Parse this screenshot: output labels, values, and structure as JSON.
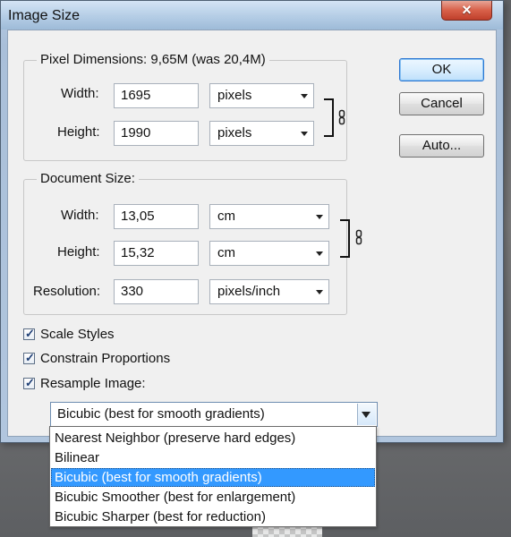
{
  "window": {
    "title": "Image Size",
    "close_icon": "close-icon"
  },
  "buttons": {
    "ok": "OK",
    "cancel": "Cancel",
    "auto": "Auto..."
  },
  "pixel_dimensions": {
    "title": "Pixel Dimensions:  9,65M (was 20,4M)",
    "width_label": "Width:",
    "width_value": "1695",
    "width_unit": "pixels",
    "height_label": "Height:",
    "height_value": "1990",
    "height_unit": "pixels",
    "link_icon": "link-icon"
  },
  "document_size": {
    "title": "Document Size:",
    "width_label": "Width:",
    "width_value": "13,05",
    "width_unit": "cm",
    "height_label": "Height:",
    "height_value": "15,32",
    "height_unit": "cm",
    "resolution_label": "Resolution:",
    "resolution_value": "330",
    "resolution_unit": "pixels/inch",
    "link_icon": "link-icon"
  },
  "options": {
    "scale_styles": {
      "label": "Scale Styles",
      "checked": true
    },
    "constrain_proportions": {
      "label": "Constrain Proportions",
      "checked": true
    },
    "resample_image": {
      "label": "Resample Image:",
      "checked": true
    }
  },
  "resample": {
    "selected": "Bicubic (best for smooth gradients)",
    "dropdown_icon": "chevron-down-icon",
    "options": [
      "Nearest Neighbor (preserve hard edges)",
      "Bilinear",
      "Bicubic (best for smooth gradients)",
      "Bicubic Smoother (best for enlargement)",
      "Bicubic Sharper (best for reduction)"
    ],
    "highlighted_option": "Bicubic (best for smooth gradients)"
  },
  "colors": {
    "dialog_frame": "#b1c6de",
    "client_background": "#f0f0f0",
    "selected_option": "#3399ff",
    "default_button_border": "#2a76d2",
    "close_button": "#d9624b"
  }
}
